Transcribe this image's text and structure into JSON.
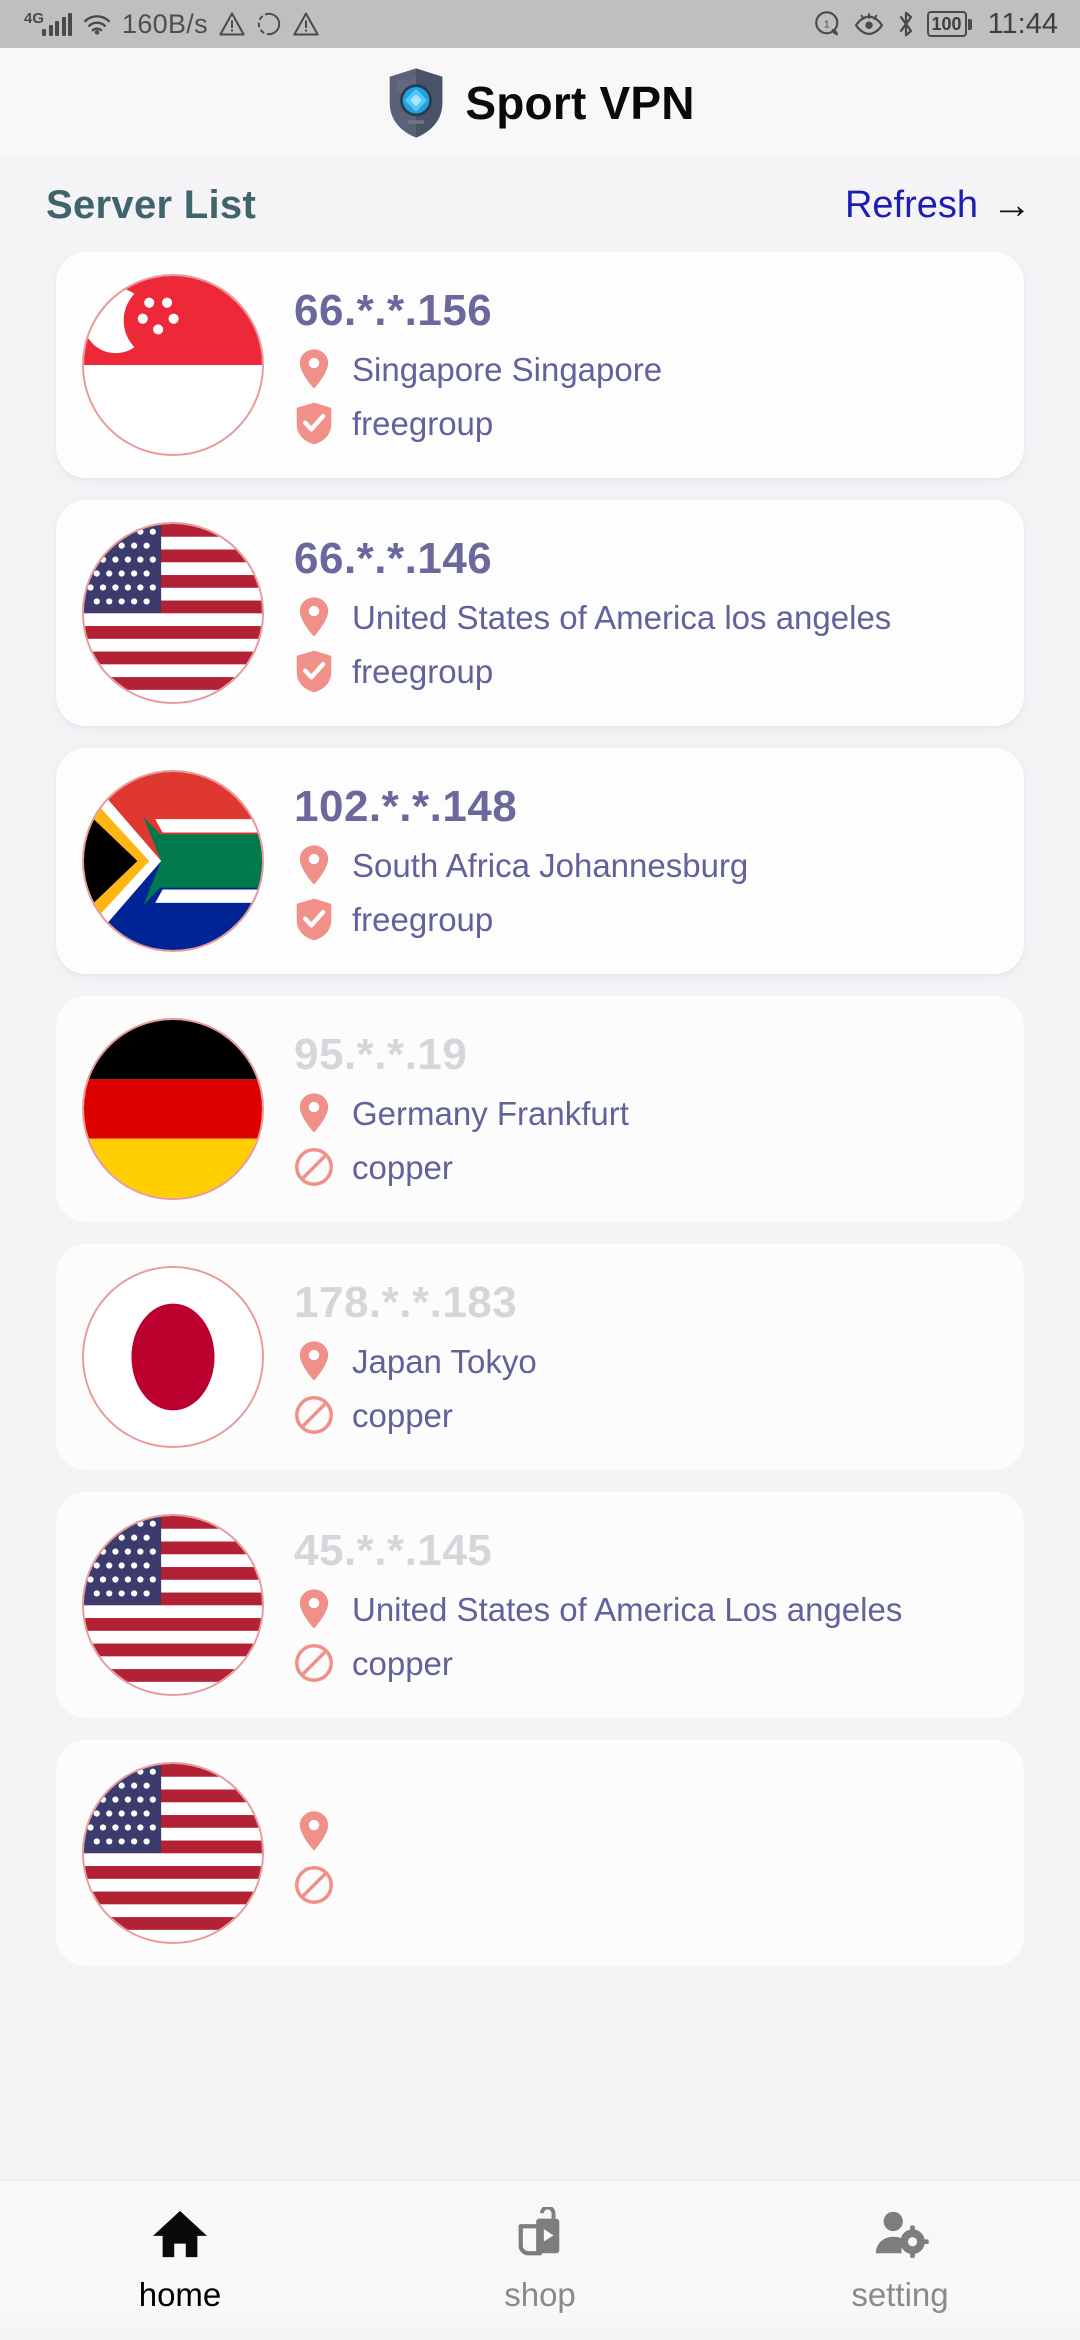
{
  "status_bar": {
    "network_type": "4G",
    "data_rate": "160B/s",
    "battery_level": "100",
    "time": "11:44",
    "icons": [
      "signal-bars-icon",
      "wifi-icon",
      "warning-triangle-icon",
      "circle-sync-icon",
      "warning-triangle-icon",
      "power-saving-icon",
      "eye-comfort-icon",
      "bluetooth-icon",
      "battery-icon"
    ]
  },
  "app_bar": {
    "title": "Sport VPN",
    "logo_icon": "shield-vpn-logo-icon"
  },
  "section": {
    "title": "Server List",
    "refresh_label": "Refresh",
    "refresh_arrow": "→"
  },
  "colors": {
    "ip_active": "#6a689c",
    "ip_disabled": "#d6d6da",
    "text": "#62629a",
    "icon_coral": "#f08f85",
    "section_title": "#41636b",
    "refresh": "#1d1db4",
    "page_bg": "#f4f4f7",
    "card_bg": "#fdfdfe"
  },
  "servers": [
    {
      "ip": "66.*.*.156",
      "location": "Singapore Singapore",
      "group": "freegroup",
      "flag": "flag-singapore",
      "status": "available",
      "status_icon": "shield-check-icon",
      "location_icon": "location-pin-icon",
      "elevated": true
    },
    {
      "ip": "66.*.*.146",
      "location": "United States of America los angeles",
      "group": "freegroup",
      "flag": "flag-usa",
      "status": "available",
      "status_icon": "shield-check-icon",
      "location_icon": "location-pin-icon",
      "elevated": true
    },
    {
      "ip": "102.*.*.148",
      "location": "South Africa Johannesburg",
      "group": "freegroup",
      "flag": "flag-south-africa",
      "status": "available",
      "status_icon": "shield-check-icon",
      "location_icon": "location-pin-icon",
      "elevated": true
    },
    {
      "ip": "95.*.*.19",
      "location": "Germany Frankfurt",
      "group": "copper",
      "flag": "flag-germany",
      "status": "locked",
      "status_icon": "no-entry-icon",
      "location_icon": "location-pin-icon",
      "elevated": false
    },
    {
      "ip": "178.*.*.183",
      "location": "Japan Tokyo",
      "group": "copper",
      "flag": "flag-japan",
      "status": "locked",
      "status_icon": "no-entry-icon",
      "location_icon": "location-pin-icon",
      "elevated": false
    },
    {
      "ip": "45.*.*.145",
      "location": "United States of America Los angeles",
      "group": "copper",
      "flag": "flag-usa",
      "status": "locked",
      "status_icon": "no-entry-icon",
      "location_icon": "location-pin-icon",
      "elevated": false
    },
    {
      "ip": "",
      "location": "",
      "group": "",
      "flag": "flag-usa",
      "status": "locked",
      "status_icon": "no-entry-icon",
      "location_icon": "location-pin-icon",
      "elevated": false
    }
  ],
  "bottom_nav": [
    {
      "label": "home",
      "icon": "home-icon",
      "active": true
    },
    {
      "label": "shop",
      "icon": "shop-bag-play-icon",
      "active": false
    },
    {
      "label": "setting",
      "icon": "user-gear-icon",
      "active": false
    }
  ]
}
